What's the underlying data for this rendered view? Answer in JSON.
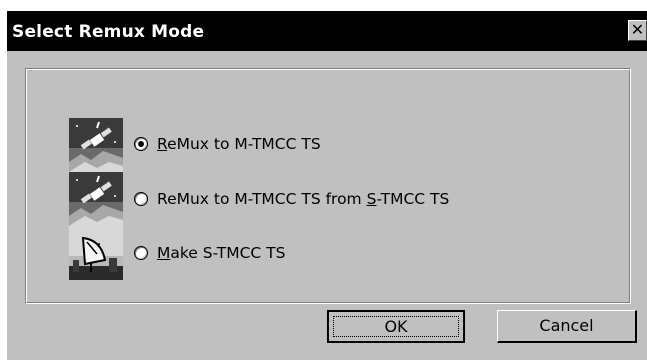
{
  "window": {
    "title": "Select Remux Mode",
    "close_glyph": "✕"
  },
  "options": [
    {
      "pre": "",
      "accel": "R",
      "post": "eMux to M-TMCC TS",
      "checked": true,
      "icon": "satellite-icon"
    },
    {
      "pre": "ReMux to M-TMCC TS from ",
      "accel": "S",
      "post": "-TMCC TS",
      "checked": false,
      "icon": "satellite-icon"
    },
    {
      "pre": "",
      "accel": "M",
      "post": "ake S-TMCC TS",
      "checked": false,
      "icon": "dish-antenna-icon"
    }
  ],
  "buttons": {
    "ok": "OK",
    "cancel": "Cancel"
  }
}
